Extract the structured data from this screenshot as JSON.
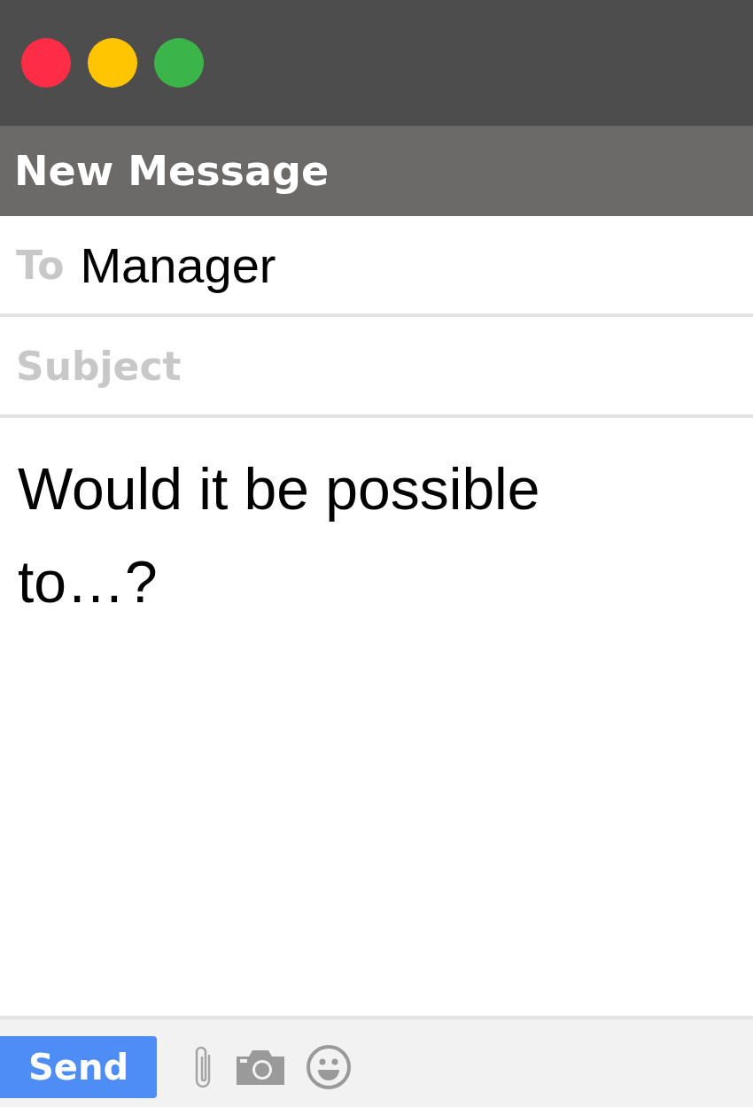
{
  "window": {
    "controls": [
      {
        "color": "#ff2d46"
      },
      {
        "color": "#ffc500"
      },
      {
        "color": "#3bb54a"
      }
    ]
  },
  "header": {
    "title": "New Message"
  },
  "to": {
    "label": "To",
    "value": "Manager"
  },
  "subject": {
    "placeholder": "Subject"
  },
  "body": {
    "value": "Would it be possible to…?"
  },
  "toolbar": {
    "send": "Send"
  }
}
